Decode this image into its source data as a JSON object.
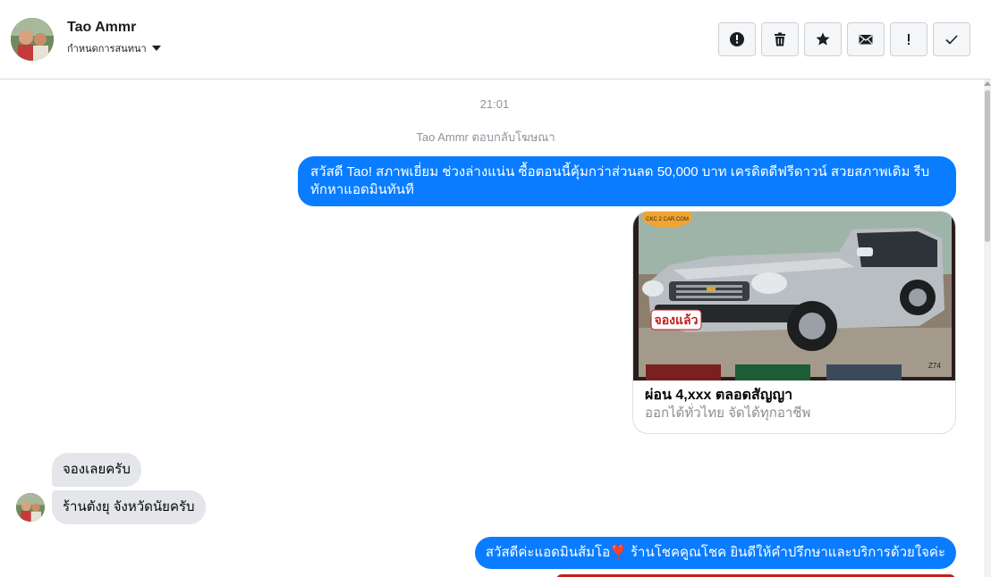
{
  "header": {
    "contact_name": "Tao Ammr",
    "assign_label": "กำหนดการสนทนา"
  },
  "toolbar": [
    {
      "name": "report-spam-button",
      "icon": "alert-circle-icon"
    },
    {
      "name": "delete-button",
      "icon": "trash-icon"
    },
    {
      "name": "star-button",
      "icon": "star-icon"
    },
    {
      "name": "mark-unread-button",
      "icon": "envelope-icon"
    },
    {
      "name": "mark-important-button",
      "icon": "exclamation-icon"
    },
    {
      "name": "mark-done-button",
      "icon": "check-icon"
    }
  ],
  "thread": {
    "timestamp": "21:01",
    "ad_reply_notice": "Tao Ammr ตอบกลับโฆษณา",
    "outgoing_message_1": "สวัสดี Tao!  สภาพเยี่ยม ช่วงล่างแน่น  ซื้อตอนนี้คุ้มกว่าส่วนลด 50,000 บาท เครดิตดีฟรีดาวน์  สวยสภาพเดิม รีบทักหาแอดมินทันที",
    "ad_card": {
      "title": "ผ่อน 4,xxx ตลอดสัญญา",
      "subtitle": "ออกได้ทั่วไทย จัดได้ทุกอาชีพ",
      "image_logo_text": "CKC 2 CAR.COM",
      "image_badge_text": "จองแล้ว",
      "image_code_text": "Z74"
    },
    "incoming_message_1": "จองเลยครับ",
    "incoming_message_2": "ร้านตังยุ จังหวัดนัยครับ",
    "outgoing_message_2": "สวัสดีค่ะแอดมินส้มโอ❣️ ร้านโชคคูณโชค ยินดีให้คำปรึกษาและบริการด้วยใจค่ะ"
  },
  "colors": {
    "outgoing_bubble": "#0a7cff",
    "incoming_bubble": "#e4e6eb",
    "meta_text": "#90949c"
  }
}
